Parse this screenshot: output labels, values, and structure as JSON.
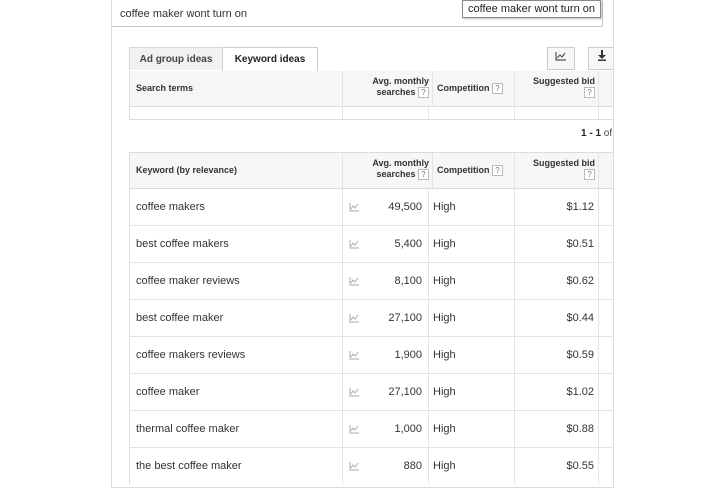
{
  "search": {
    "query": "coffee maker wont turn on",
    "tooltip": "coffee maker wont turn on"
  },
  "tabs": [
    {
      "label": "Ad group ideas"
    },
    {
      "label": "Keyword ideas"
    }
  ],
  "toolbar": {
    "chart_icon": "line-chart-icon",
    "download_icon": "download-icon"
  },
  "search_terms_table": {
    "headers": {
      "term": "Search terms",
      "avg_line1": "Avg. monthly",
      "avg_line2": "searches",
      "competition": "Competition",
      "bid_line1": "Suggested bid",
      "help": "?"
    }
  },
  "pager": {
    "range": "1 - 1",
    "suffix": "of"
  },
  "keyword_table": {
    "headers": {
      "keyword": "Keyword (by relevance)",
      "avg_line1": "Avg. monthly",
      "avg_line2": "searches",
      "competition": "Competition",
      "bid_line1": "Suggested bid",
      "help": "?"
    },
    "rows": [
      {
        "keyword": "coffee makers",
        "searches": "49,500",
        "competition": "High",
        "bid": "$1.12"
      },
      {
        "keyword": "best coffee makers",
        "searches": "5,400",
        "competition": "High",
        "bid": "$0.51"
      },
      {
        "keyword": "coffee maker reviews",
        "searches": "8,100",
        "competition": "High",
        "bid": "$0.62"
      },
      {
        "keyword": "best coffee maker",
        "searches": "27,100",
        "competition": "High",
        "bid": "$0.44"
      },
      {
        "keyword": "coffee makers reviews",
        "searches": "1,900",
        "competition": "High",
        "bid": "$0.59"
      },
      {
        "keyword": "coffee maker",
        "searches": "27,100",
        "competition": "High",
        "bid": "$1.02"
      },
      {
        "keyword": "thermal coffee maker",
        "searches": "1,000",
        "competition": "High",
        "bid": "$0.88"
      },
      {
        "keyword": "the best coffee maker",
        "searches": "880",
        "competition": "High",
        "bid": "$0.55"
      }
    ]
  },
  "colors": {
    "header_bg": "#f6f6f6",
    "border": "#dcdcdc",
    "text": "#333333"
  }
}
